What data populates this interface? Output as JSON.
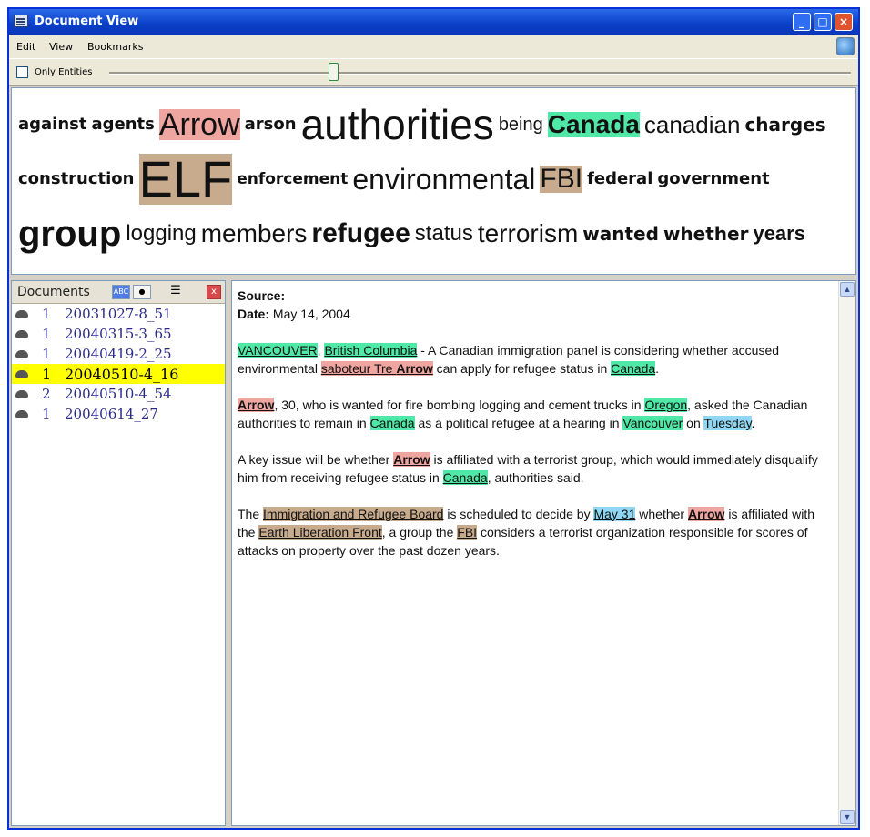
{
  "window": {
    "title": "Document View"
  },
  "menu": {
    "items": [
      "Edit",
      "View",
      "Bookmarks"
    ]
  },
  "toolbar": {
    "only_entities_label": "Only Entities",
    "only_entities_checked": false,
    "slider_level": 0.3
  },
  "cloud": {
    "lines": [
      [
        {
          "text": "against",
          "size": 18,
          "weight": "bold",
          "hl": ""
        },
        {
          "text": "agents",
          "size": 18,
          "weight": "bold",
          "hl": ""
        },
        {
          "text": "Arrow",
          "size": 34,
          "weight": "normal",
          "hl": "person"
        },
        {
          "text": "arson",
          "size": 18,
          "weight": "bold",
          "hl": ""
        },
        {
          "text": "authorities",
          "size": 46,
          "weight": "normal",
          "hl": ""
        },
        {
          "text": "being",
          "size": 20,
          "weight": "normal",
          "hl": ""
        },
        {
          "text": "Canada",
          "size": 28,
          "weight": "bold",
          "hl": "location"
        },
        {
          "text": "canadian",
          "size": 26,
          "weight": "normal",
          "hl": ""
        },
        {
          "text": "charges",
          "size": 20,
          "weight": "bold",
          "hl": ""
        }
      ],
      [
        {
          "text": "construction",
          "size": 18,
          "weight": "bold",
          "hl": ""
        },
        {
          "text": "ELF",
          "size": 56,
          "weight": "normal",
          "hl": "organization"
        },
        {
          "text": "enforcement",
          "size": 17,
          "weight": "bold",
          "hl": ""
        },
        {
          "text": "environmental",
          "size": 32,
          "weight": "normal",
          "hl": ""
        },
        {
          "text": "FBI",
          "size": 30,
          "weight": "normal",
          "hl": "organization"
        },
        {
          "text": "federal",
          "size": 18,
          "weight": "bold",
          "hl": ""
        },
        {
          "text": "government",
          "size": 18,
          "weight": "bold",
          "hl": ""
        }
      ],
      [
        {
          "text": "group",
          "size": 40,
          "weight": "bold",
          "hl": ""
        },
        {
          "text": "logging",
          "size": 24,
          "weight": "normal",
          "hl": ""
        },
        {
          "text": "members",
          "size": 28,
          "weight": "normal",
          "hl": ""
        },
        {
          "text": "refugee",
          "size": 30,
          "weight": "bold",
          "hl": ""
        },
        {
          "text": "status",
          "size": 24,
          "weight": "normal",
          "hl": ""
        },
        {
          "text": "terrorism",
          "size": 28,
          "weight": "normal",
          "hl": ""
        },
        {
          "text": "wanted",
          "size": 20,
          "weight": "bold",
          "hl": ""
        },
        {
          "text": "whether",
          "size": 20,
          "weight": "bold",
          "hl": ""
        },
        {
          "text": "years",
          "size": 22,
          "weight": "bold",
          "hl": ""
        }
      ]
    ]
  },
  "documents": {
    "header": "Documents",
    "buttons": {
      "abc": "ABC",
      "close": "x"
    },
    "items": [
      {
        "count": "1",
        "name": "20031027-8_51",
        "selected": false
      },
      {
        "count": "1",
        "name": "20040315-3_65",
        "selected": false
      },
      {
        "count": "1",
        "name": "20040419-2_25",
        "selected": false
      },
      {
        "count": "1",
        "name": "20040510-4_16",
        "selected": true
      },
      {
        "count": "2",
        "name": "20040510-4_54",
        "selected": false
      },
      {
        "count": "1",
        "name": "20040614_27",
        "selected": false
      }
    ]
  },
  "document": {
    "source_label": "Source:",
    "source_value": "",
    "date_label": "Date:",
    "date_value": "May 14, 2004",
    "paragraphs": [
      [
        {
          "t": "VANCOUVER",
          "e": "loc"
        },
        {
          "t": ", "
        },
        {
          "t": "British Columbia",
          "e": "loc"
        },
        {
          "t": " - A Canadian immigration panel is considering whether accused environmental "
        },
        {
          "t": "saboteur Tre ",
          "e": "per"
        },
        {
          "t": "Arrow",
          "e": "per",
          "b": true
        },
        {
          "t": " can apply for refugee status in "
        },
        {
          "t": "Canada",
          "e": "loc"
        },
        {
          "t": "."
        }
      ],
      [
        {
          "t": "Arrow",
          "e": "per",
          "b": true
        },
        {
          "t": ", 30, who is wanted for fire bombing logging and cement trucks in "
        },
        {
          "t": "Oregon",
          "e": "loc"
        },
        {
          "t": ", asked the Canadian authorities to remain in "
        },
        {
          "t": "Canada",
          "e": "loc"
        },
        {
          "t": " as a political refugee at a hearing in "
        },
        {
          "t": "Vancouver",
          "e": "loc"
        },
        {
          "t": " on "
        },
        {
          "t": "Tuesday",
          "e": "date"
        },
        {
          "t": "."
        }
      ],
      [
        {
          "t": "A key issue will be whether "
        },
        {
          "t": "Arrow",
          "e": "per",
          "b": true
        },
        {
          "t": " is affiliated with a terrorist group, which would immediately disqualify him from receiving refugee status in "
        },
        {
          "t": "Canada",
          "e": "loc"
        },
        {
          "t": ", authorities said."
        }
      ],
      [
        {
          "t": "The "
        },
        {
          "t": "Immigration and Refugee Board",
          "e": "org"
        },
        {
          "t": " is scheduled to decide by "
        },
        {
          "t": "May 31",
          "e": "date"
        },
        {
          "t": " whether "
        },
        {
          "t": "Arrow",
          "e": "per",
          "b": true
        },
        {
          "t": " is affiliated with the "
        },
        {
          "t": "Earth Liberation Front",
          "e": "org"
        },
        {
          "t": ", a group the "
        },
        {
          "t": "FBI",
          "e": "org"
        },
        {
          "t": " considers a terrorist organization responsible for scores of attacks on property over the past dozen years."
        }
      ]
    ]
  },
  "colors": {
    "person": "#f0a6a0",
    "location": "#4fe8a6",
    "organization": "#c8ab8d",
    "date": "#8fd8f4",
    "selected_row": "#ffff00",
    "titlebar": "#0a3fc8"
  }
}
